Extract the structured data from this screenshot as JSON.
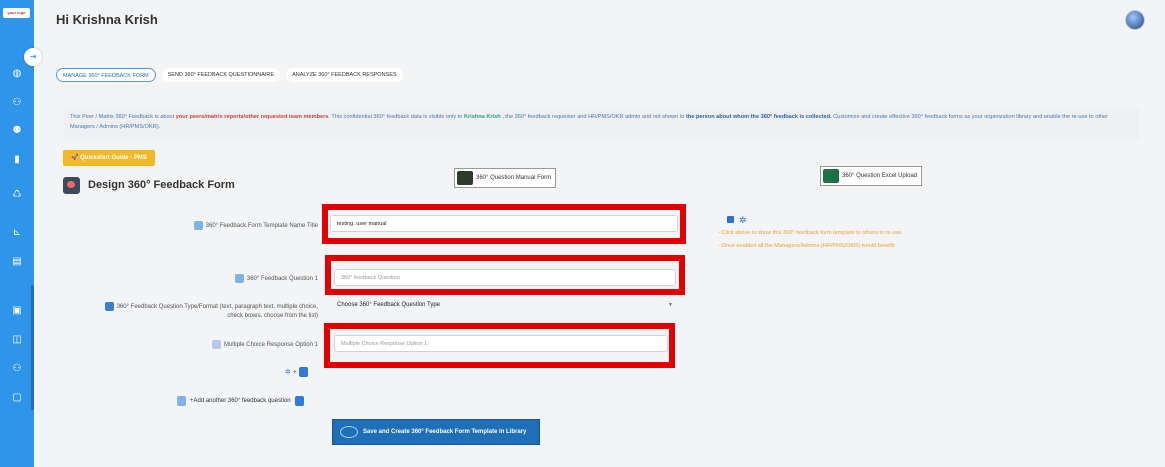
{
  "sidebar": {
    "logo": "your logo",
    "toggle_icon": "collapse-arrow-icon",
    "icons": [
      "globe-icon",
      "team-icon",
      "org-icon",
      "book-icon",
      "feedback-icon",
      "hierarchy-icon",
      "report-icon",
      "calendar-icon",
      "book-open-icon",
      "group-icon",
      "survey-icon"
    ]
  },
  "header": {
    "greeting": "Hi Krishna Krish"
  },
  "tabs": [
    {
      "label": "MANAGE 360° FEEDBACK FORM"
    },
    {
      "label": "SEND 360° FEEDBACK QUESTIONNAIRE"
    },
    {
      "label": "ANALYZE 360° FEEDBACK RESPONSES"
    }
  ],
  "info": {
    "p1": "This Peer / Matrix 360° Feedback is about ",
    "p2": "your peers/matrix reports/other requested team members",
    "p3": ". This confidential 360° feedback data is visible only to ",
    "p4": "Krishna Krish",
    "p5": " , the 360° feedback requester and HR/PMS/OKR admin and not shown to ",
    "p6": "the person about whom the 360° feedback is collected.",
    "p7": " Customize and create effective 360° feedback forms as your organization library and enable the re-use to other Managers / Admins (HR/PMS/OKR)."
  },
  "quickstart": {
    "label": "Quickstart Guide - PMS"
  },
  "form": {
    "title": "Design 360° Feedback Form",
    "manual_button": "360° Question Manual Form",
    "excel_button": "360° Question Excel Upload",
    "template_name_label": "360° Feedback Form Template Name Title",
    "template_name_value": "testing. user manual",
    "question_label": "360° Feedback Question 1",
    "question_placeholder": "360° feedback Question",
    "type_label_line1": "360° Feedback Question Type/Format (text, paragraph text, multiple choice,",
    "type_label_line2": "check boxes, choose from the list)",
    "type_select": "Choose 360° Feedback Question Type",
    "mc_label": "Multiple Choice Response Option 1",
    "mc_placeholder": "Multiple Choice Response Option 1",
    "plus_sign": "+",
    "add_question": "+Add another 360° feedback question",
    "share_note1": "- Click above to show this 360° feedback form template to others to re-use",
    "share_note2": "- Once enabled all the Managers/Admins (HR/PMS/OKR) would benefit",
    "save_button": "Save and Create 360° Feedback Form Template in Library"
  }
}
